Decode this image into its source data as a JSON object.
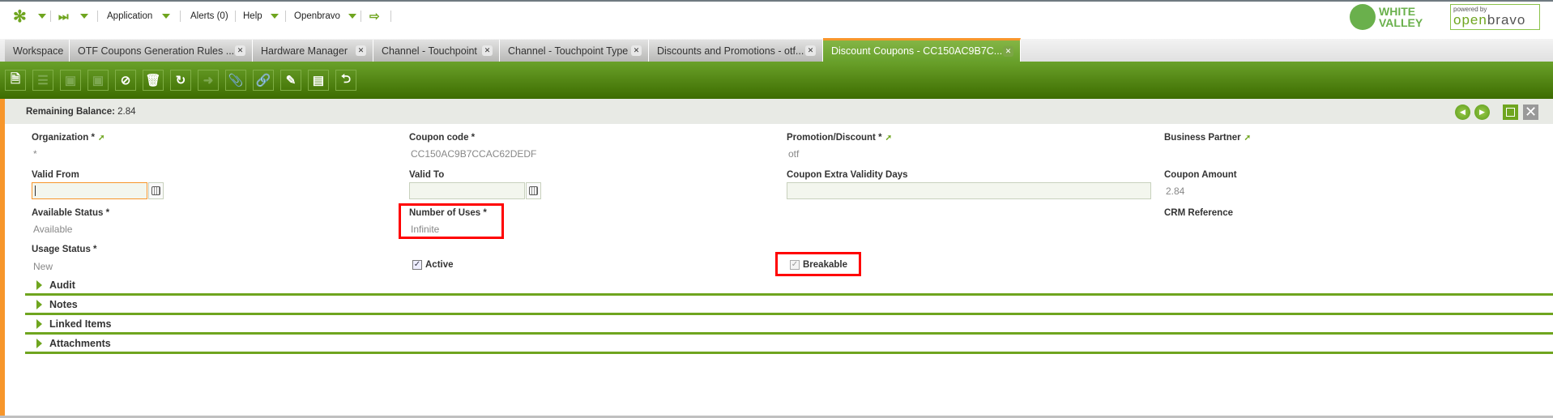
{
  "nav": {
    "application": "Application",
    "alerts": "Alerts (0)",
    "help": "Help",
    "user": "Openbravo"
  },
  "logos": {
    "white_valley": "WHITE VALLEY",
    "openbravo_powered": "powered by",
    "openbravo": "openbravo"
  },
  "tabs": [
    {
      "label": "Workspace"
    },
    {
      "label": "OTF Coupons Generation Rules ..."
    },
    {
      "label": "Hardware Manager"
    },
    {
      "label": "Channel - Touchpoint"
    },
    {
      "label": "Channel - Touchpoint Type"
    },
    {
      "label": "Discounts and Promotions - otf..."
    },
    {
      "label": "Discount Coupons - CC150AC9B7C...",
      "active": true
    }
  ],
  "toolbar": [
    "new-document-icon",
    "grid-view-icon",
    "save-icon",
    "save-close-icon",
    "cancel-icon",
    "delete-icon",
    "refresh-icon",
    "export-icon",
    "attachment-icon",
    "link-icon",
    "process-icon",
    "layout-icon",
    "undo-selection-icon"
  ],
  "balance": {
    "label": "Remaining Balance:",
    "value": "2.84"
  },
  "form": {
    "organization": {
      "label": "Organization *",
      "value": "*"
    },
    "coupon_code": {
      "label": "Coupon code *",
      "value": "CC150AC9B7CCAC62DEDF"
    },
    "promotion": {
      "label": "Promotion/Discount *",
      "value": "otf"
    },
    "business_partner": {
      "label": "Business Partner",
      "value": ""
    },
    "valid_from": {
      "label": "Valid From",
      "value": ""
    },
    "valid_to": {
      "label": "Valid To",
      "value": ""
    },
    "extra_days": {
      "label": "Coupon Extra Validity Days",
      "value": ""
    },
    "coupon_amount": {
      "label": "Coupon Amount",
      "value": "2.84"
    },
    "available_status": {
      "label": "Available Status *",
      "value": "Available"
    },
    "number_of_uses": {
      "label": "Number of Uses *",
      "value": "Infinite"
    },
    "crm_reference": {
      "label": "CRM Reference"
    },
    "usage_status": {
      "label": "Usage Status *",
      "value": "New"
    },
    "active": {
      "label": "Active",
      "checked": true
    },
    "breakable": {
      "label": "Breakable",
      "checked": true
    }
  },
  "sections": [
    "Audit",
    "Notes",
    "Linked Items",
    "Attachments"
  ],
  "colors": {
    "accent": "#6fa51f",
    "toolbar": "#4a7a0c",
    "active_tab_top": "#f7962b",
    "highlight": "#ff0000"
  }
}
